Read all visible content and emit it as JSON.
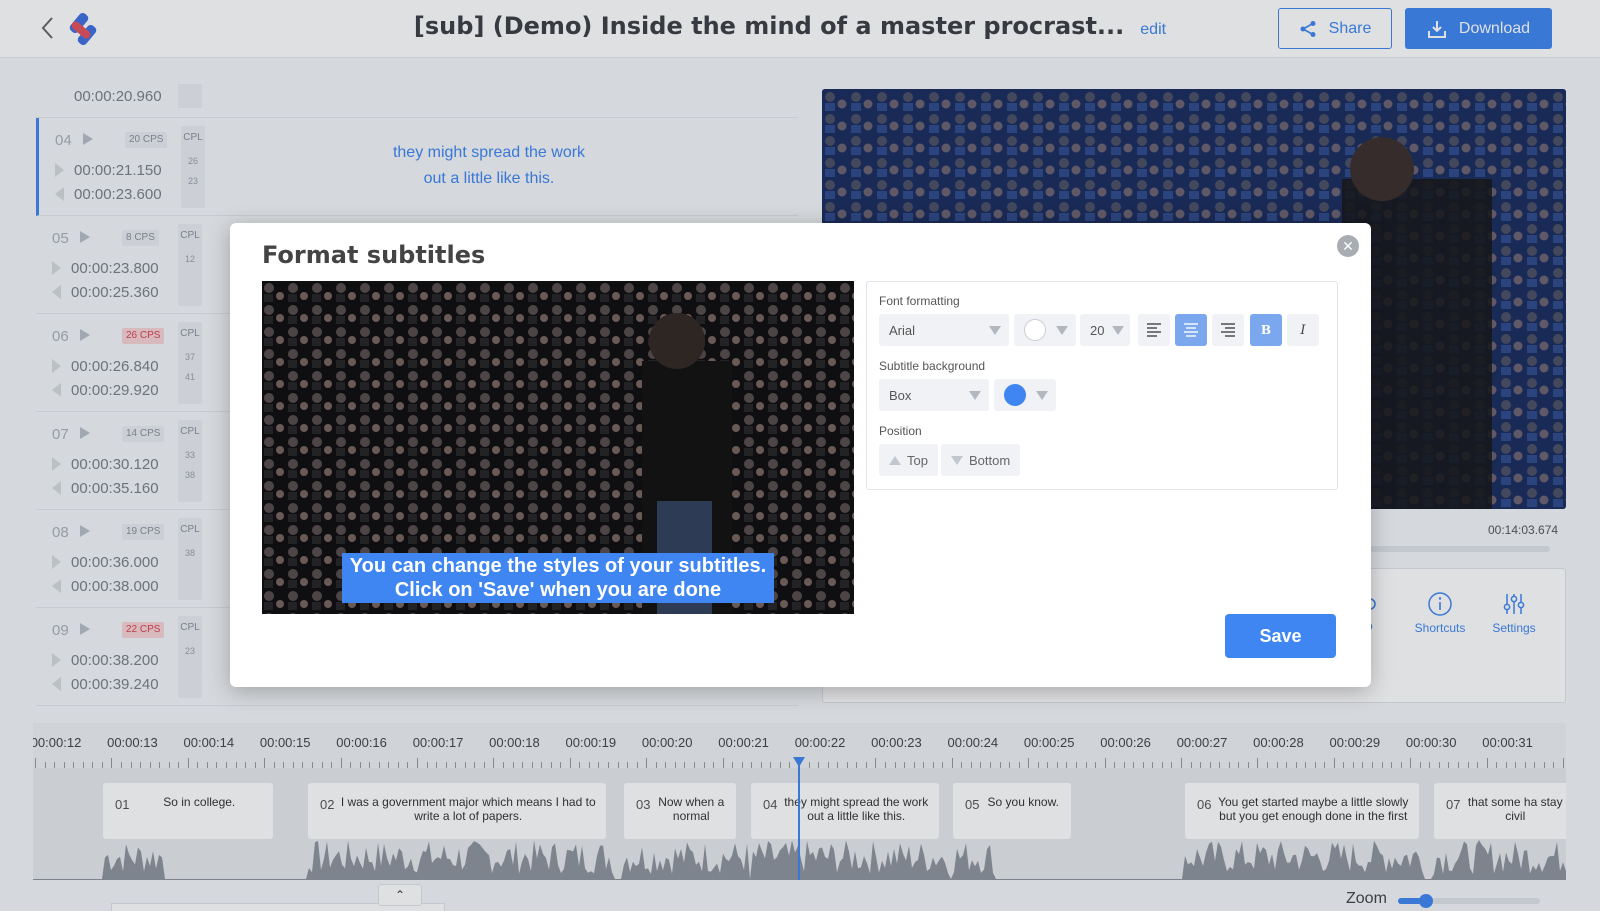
{
  "header": {
    "title": "[sub] (Demo) Inside the mind of a master procrast...",
    "edit_label": "edit",
    "share_label": "Share",
    "download_label": "Download"
  },
  "subtitle_list": {
    "top_time": "00:00:20.960",
    "rows": [
      {
        "num": "04",
        "cps": "20 CPS",
        "cps_warn": false,
        "cpl_label": "CPL",
        "cpl": [
          "26",
          "23"
        ],
        "start": "00:00:21.150",
        "end": "00:00:23.600",
        "text_lines": [
          "they might spread the work",
          "out a little like this."
        ]
      },
      {
        "num": "05",
        "cps": "8 CPS",
        "cps_warn": false,
        "cpl_label": "CPL",
        "cpl": [
          "12"
        ],
        "start": "00:00:23.800",
        "end": "00:00:25.360"
      },
      {
        "num": "06",
        "cps": "26 CPS",
        "cps_warn": true,
        "cpl_label": "CPL",
        "cpl": [
          "37",
          "41"
        ],
        "start": "00:00:26.840",
        "end": "00:00:29.920"
      },
      {
        "num": "07",
        "cps": "14 CPS",
        "cps_warn": false,
        "cpl_label": "CPL",
        "cpl": [
          "33",
          "38"
        ],
        "start": "00:00:30.120",
        "end": "00:00:35.160"
      },
      {
        "num": "08",
        "cps": "19 CPS",
        "cps_warn": false,
        "cpl_label": "CPL",
        "cpl": [
          "38"
        ],
        "start": "00:00:36.000",
        "end": "00:00:38.000"
      },
      {
        "num": "09",
        "cps": "22 CPS",
        "cps_warn": true,
        "cpl_label": "CPL",
        "cpl": [
          "23"
        ],
        "start": "00:00:38.200",
        "end": "00:00:39.240"
      }
    ]
  },
  "player": {
    "total_time": "00:14:03.674"
  },
  "tools": {
    "undo_label": "do",
    "shortcuts_label": "Shortcuts",
    "settings_label": "Settings"
  },
  "timeline": {
    "ticks": [
      "00:00:12",
      "00:00:13",
      "00:00:14",
      "00:00:15",
      "00:00:16",
      "00:00:17",
      "00:00:18",
      "00:00:19",
      "00:00:20",
      "00:00:21",
      "00:00:22",
      "00:00:23",
      "00:00:24",
      "00:00:25",
      "00:00:26",
      "00:00:27",
      "00:00:28",
      "00:00:29",
      "00:00:30",
      "00:00:31"
    ],
    "cues": [
      {
        "num": "01",
        "text": "So in college."
      },
      {
        "num": "02",
        "text": "I was a government major which means I had to write a lot of papers."
      },
      {
        "num": "03",
        "text": "Now when a normal"
      },
      {
        "num": "04",
        "text": "they might spread the work out a little like this."
      },
      {
        "num": "05",
        "text": "So you know."
      },
      {
        "num": "06",
        "text": "You get started maybe a little slowly but you get enough done in the first"
      },
      {
        "num": "07",
        "text": "that some ha stay civil"
      }
    ],
    "zoom_label": "Zoom",
    "zoom_level": 0.2
  },
  "modal": {
    "title": "Format subtitles",
    "preview_caption_line1": "You can change the styles of your subtitles.",
    "preview_caption_line2": "Click on 'Save' when you are done",
    "font_formatting_label": "Font formatting",
    "font_family": "Arial",
    "font_color": "#ffffff",
    "font_size": "20",
    "alignment": "center",
    "bold_on": true,
    "italic_on": false,
    "subtitle_background_label": "Subtitle background",
    "background_style": "Box",
    "background_color": "#3f86f2",
    "position_label": "Position",
    "position_top_label": "Top",
    "position_bottom_label": "Bottom",
    "save_label": "Save"
  },
  "icons": {
    "back": "back-chevron-icon",
    "share": "share-icon",
    "download": "download-icon",
    "close": "close-icon"
  },
  "colors": {
    "accent": "#3f86f2",
    "warn_badge": "#d9434f"
  }
}
